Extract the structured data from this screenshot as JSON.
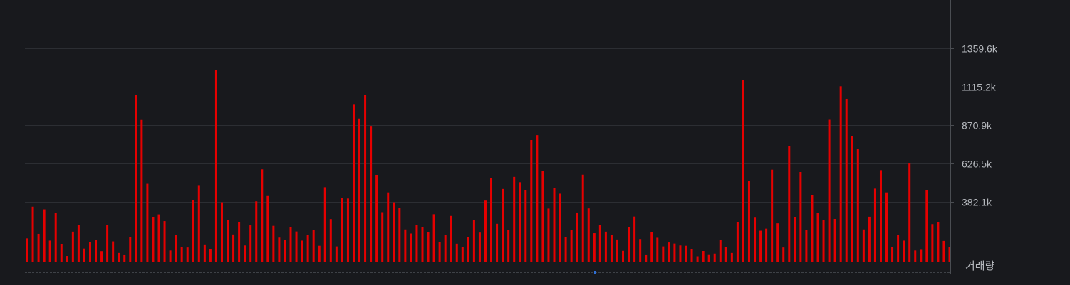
{
  "chart_data": {
    "type": "bar",
    "ylabel": "거래량",
    "ylim": [
      0,
      1359.6
    ],
    "yticks": [
      {
        "value": 382.1,
        "label": "382.1k"
      },
      {
        "value": 626.5,
        "label": "626.5k"
      },
      {
        "value": 870.9,
        "label": "870.9k"
      },
      {
        "value": 1115.2,
        "label": "1115.2k"
      },
      {
        "value": 1359.6,
        "label": "1359.6k"
      }
    ],
    "grid": true,
    "series": [
      {
        "values": [
          148,
          350,
          177,
          333,
          134,
          311,
          113,
          36,
          191,
          232,
          83,
          126,
          138,
          67,
          233,
          129,
          55,
          41,
          155,
          1065,
          903,
          496,
          281,
          301,
          258,
          71,
          170,
          92,
          90,
          392,
          483,
          105,
          80,
          1220,
          378,
          264,
          173,
          250,
          103,
          231,
          384,
          588,
          418,
          228,
          153,
          137,
          219,
          192,
          134,
          171,
          203,
          101,
          474,
          271,
          97,
          405,
          402,
          1000,
          912,
          1065,
          865,
          553,
          315,
          441,
          378,
          342,
          205,
          179,
          233,
          220,
          186,
          302,
          124,
          172,
          291,
          114,
          93,
          156,
          267,
          185,
          389,
          532,
          241,
          463,
          200,
          540,
          506,
          455,
          775,
          806,
          580,
          338,
          468,
          433,
          156,
          201,
          313,
          554,
          339,
          181,
          232,
          191,
          168,
          141,
          69,
          222,
          287,
          144,
          41,
          189,
          152,
          97,
          122,
          115,
          103,
          101,
          80,
          34,
          68,
          42,
          51,
          139,
          91,
          55,
          251,
          1160,
          513,
          280,
          197,
          210,
          586,
          244,
          90,
          737,
          284,
          571,
          200,
          426,
          310,
          265,
          904,
          272,
          1118,
          1038,
          799,
          718,
          205,
          286,
          465,
          583,
          441,
          94,
          172,
          134,
          625,
          71,
          75,
          455,
          239,
          250,
          132,
          95
        ]
      }
    ],
    "colors": {
      "background": "#18191d",
      "bar": "#e60000",
      "grid": "#2c2e33",
      "axis": "#4a4d52"
    }
  }
}
